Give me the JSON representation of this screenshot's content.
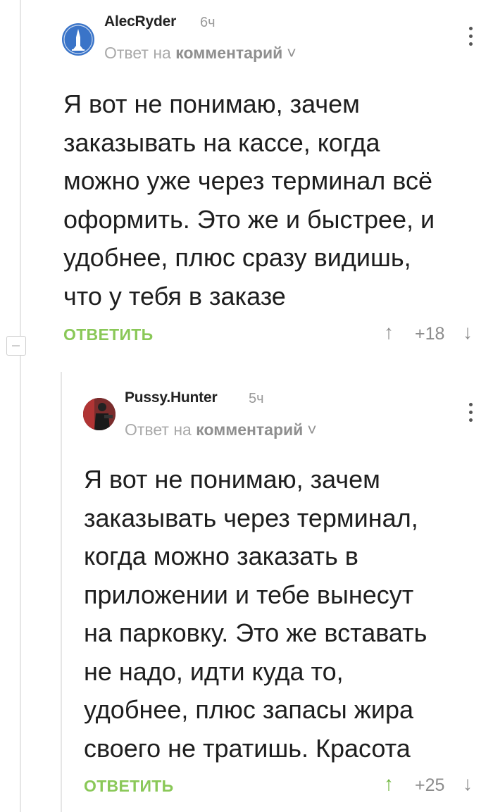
{
  "comments": [
    {
      "username": "AlecRyder",
      "time": "6ч",
      "reply_prefix": "Ответ на",
      "reply_target": "комментарий",
      "text": "Я вот не понимаю, зачем\nзаказывать на кассе, когда\nможно уже через терминал всё\nоформить. Это же и быстрее, и\nудобнее, плюс сразу видишь,\nчто у тебя в заказе",
      "reply_label": "ОТВЕТИТЬ",
      "rating": "+18",
      "avatar_color": "#3a74c8"
    },
    {
      "username": "Pussy.Hunter",
      "time": "5ч",
      "reply_prefix": "Ответ на",
      "reply_target": "комментарий",
      "text": "Я вот не понимаю, зачем\nзаказывать через терминал,\nкогда можно заказать в\nприложении и тебе вынесут\nна парковку. Это же вставать\nне надо, идти куда то,\nудобнее, плюс запасы жира\nсвоего не тратишь. Красота",
      "reply_label": "ОТВЕТИТЬ",
      "rating": "+25",
      "avatar_color": "#8a2a2a"
    }
  ],
  "icons": {
    "upvote": "↑",
    "downvote": "↓",
    "caret": "˅"
  },
  "colors": {
    "reply_green": "#8ac858",
    "upvoted_green": "#6db53a",
    "thread_line": "#e6e6e6"
  }
}
